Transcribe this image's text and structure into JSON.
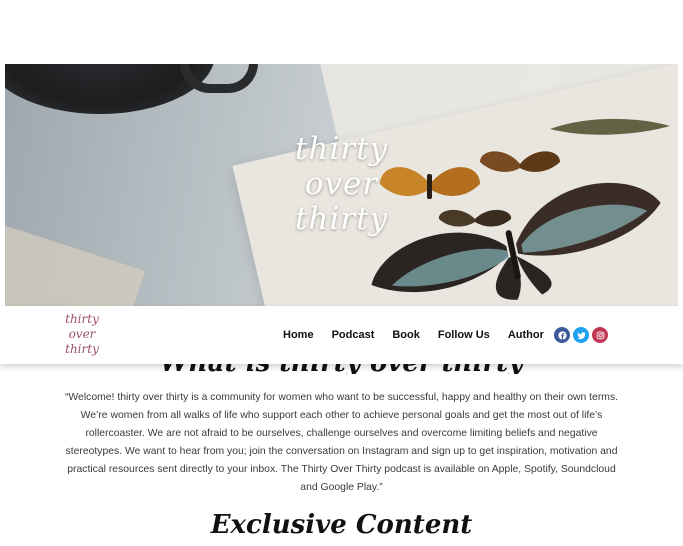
{
  "hero": {
    "title_lines": [
      "thirty",
      "over",
      "thirty"
    ]
  },
  "nav": {
    "logo_lines": [
      "thirty",
      "over",
      "thirty"
    ],
    "links": [
      "Home",
      "Podcast",
      "Book",
      "Follow Us",
      "Author"
    ],
    "socials": [
      {
        "name": "facebook",
        "color": "#3b5998"
      },
      {
        "name": "twitter",
        "color": "#1da1f2"
      },
      {
        "name": "instagram",
        "color": "#c13553"
      }
    ]
  },
  "about": {
    "heading": "What is thirty over thirty",
    "paragraph": "“Welcome! thirty over thirty is a community for women who want to be successful, happy and healthy on their own terms. We’re women from all walks of life who support each other to achieve personal goals and get the most out of life’s rollercoaster. We are not afraid to be ourselves, challenge ourselves and overcome limiting beliefs and negative stereotypes. We want to hear from you; join the conversation on Instagram and sign up to get inspiration, motivation and practical resources sent directly to your inbox. The Thirty Over Thirty podcast is available on Apple, Spotify, Soundcloud and Google Play.”"
  },
  "exclusive": {
    "heading": "Exclusive Content"
  }
}
